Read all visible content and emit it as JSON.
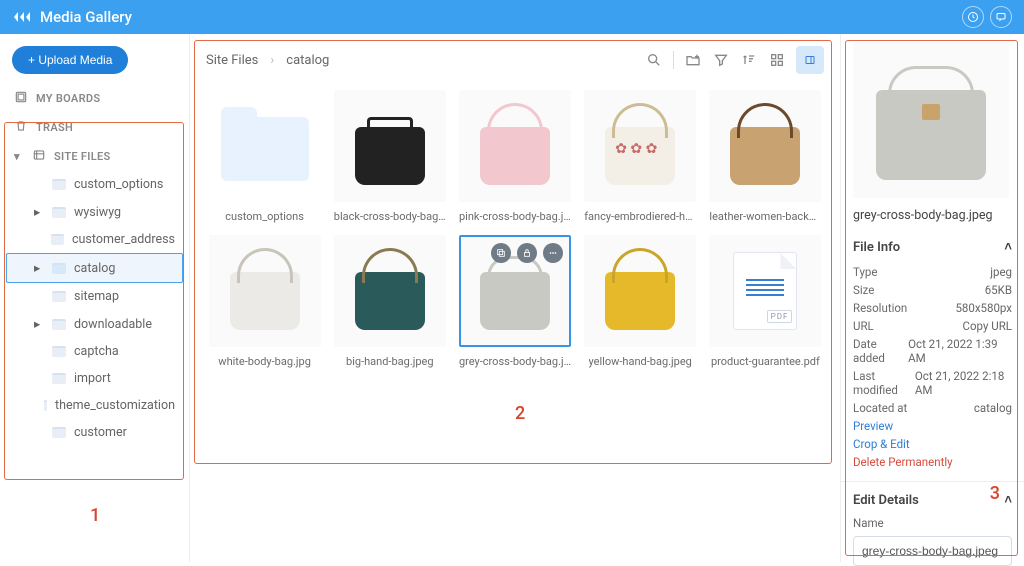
{
  "header": {
    "title": "Media Gallery"
  },
  "sidebar": {
    "upload_label": "+ Upload Media",
    "sections": {
      "my_boards": "MY BOARDS",
      "trash": "TRASH",
      "site_files": "SITE FILES"
    },
    "items": [
      "custom_options",
      "wysiwyg",
      "customer_address",
      "catalog",
      "sitemap",
      "downloadable",
      "captcha",
      "import",
      "theme_customization",
      "customer"
    ],
    "selected_index": 3
  },
  "breadcrumb": {
    "root": "Site Files",
    "current": "catalog"
  },
  "tiles": [
    {
      "label": "custom_options",
      "kind": "folder"
    },
    {
      "label": "black-cross-body-bag.jpeg",
      "kind": "image",
      "variant": "black"
    },
    {
      "label": "pink-cross-body-bag.jpeg",
      "kind": "image",
      "variant": "pink"
    },
    {
      "label": "fancy-embrodiered-hand...",
      "kind": "image",
      "variant": "flower"
    },
    {
      "label": "leather-women-backpac...",
      "kind": "image",
      "variant": "tan"
    },
    {
      "label": "white-body-bag.jpg",
      "kind": "image",
      "variant": "white"
    },
    {
      "label": "big-hand-bag.jpeg",
      "kind": "image",
      "variant": "teal"
    },
    {
      "label": "grey-cross-body-bag.jpeg",
      "kind": "image",
      "variant": "grey",
      "selected": true
    },
    {
      "label": "yellow-hand-bag.jpeg",
      "kind": "image",
      "variant": "yellow"
    },
    {
      "label": "product-guarantee.pdf",
      "kind": "pdf"
    }
  ],
  "details": {
    "filename": "grey-cross-body-bag.jpeg",
    "file_info_title": "File Info",
    "rows": {
      "type_k": "Type",
      "type_v": "jpeg",
      "size_k": "Size",
      "size_v": "65KB",
      "res_k": "Resolution",
      "res_v": "580x580px",
      "url_k": "URL",
      "url_v": "Copy URL",
      "added_k": "Date added",
      "added_v": "Oct 21, 2022 1:39 AM",
      "mod_k": "Last modified",
      "mod_v": "Oct 21, 2022 2:18 AM",
      "loc_k": "Located at",
      "loc_v": "catalog"
    },
    "actions": {
      "preview": "Preview",
      "crop": "Crop & Edit",
      "delete": "Delete Permanently"
    },
    "edit_title": "Edit Details",
    "name_label": "Name",
    "name_value": "grey-cross-body-bag.jpeg"
  },
  "annotations": {
    "one": "1",
    "two": "2",
    "three": "3"
  }
}
